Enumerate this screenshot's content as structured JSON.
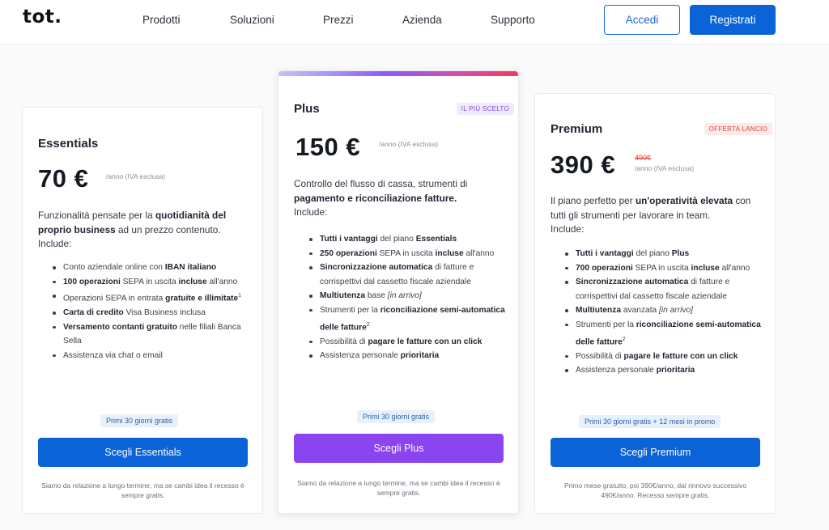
{
  "header": {
    "logo": "tot.",
    "nav": [
      "Prodotti",
      "Soluzioni",
      "Prezzi",
      "Azienda",
      "Supporto"
    ],
    "login": "Accedi",
    "signup": "Registrati"
  },
  "plans": [
    {
      "name": "Essentials",
      "price": "70 €",
      "price_note": "/anno (IVA esclusa)",
      "desc_html": "Funzionalità pensate per la <b>quotidianità del proprio business</b> ad un prezzo contenuto.<br>Include:",
      "features_html": [
        "Conto aziendale online con <b>IBAN italiano</b>",
        "<b>100 operazioni</b> SEPA in uscita <b>incluse</b> all'anno",
        "Operazioni SEPA in entrata <b>gratuite e illimitate</b><sup>1</sup>",
        "<b>Carta di credito</b> Visa Business inclusa",
        "<b>Versamento contanti gratuito</b> nelle filiali Banca Sella",
        "Assistenza via chat o email"
      ],
      "trial": "Primi 30 giorni gratis",
      "cta": "Scegli Essentials",
      "footnote": "Siamo da relazione a lungo termine, ma se cambi idea il recesso è sempre gratis."
    },
    {
      "name": "Plus",
      "badge": "IL PIÙ SCELTO",
      "price": "150 €",
      "price_note": "/anno (IVA esclusa)",
      "desc_html": "Controllo del flusso di cassa, strumenti di <b>pagamento e riconciliazione fatture.</b><br>Include:",
      "features_html": [
        "<b>Tutti i vantaggi</b> del piano <b>Essentials</b>",
        "<b>250 operazioni</b> SEPA in uscita <b>incluse</b> all'anno",
        "<b>Sincronizzazione automatica</b> di fatture e corrispettivi dal cassetto fiscale aziendale",
        "<b>Multiutenza</b> base <i>[in arrivo]</i>",
        "Strumenti per la <b>riconciliazione semi-automatica delle fatture</b><sup>2</sup>",
        "Possibilità di <b>pagare le fatture con un click</b>",
        "Assistenza personale <b>prioritaria</b>"
      ],
      "trial": "Primi 30 giorni gratis",
      "cta": "Scegli Plus",
      "footnote": "Siamo da relazione a lungo termine, ma se cambi idea il recesso è sempre gratis."
    },
    {
      "name": "Premium",
      "badge": "OFFERTA LANCIO",
      "price": "390 €",
      "old_price": "490€",
      "price_note": "/anno (IVA esclusa)",
      "desc_html": "Il piano perfetto per <b>un'operatività elevata</b> con tutti gli strumenti per lavorare in team.<br>Include:",
      "features_html": [
        "<b>Tutti i vantaggi</b> del piano <b>Plus</b>",
        "<b>700 operazioni</b> SEPA in uscita <b>incluse</b> all'anno",
        "<b>Sincronizzazione automatica</b> di fatture e corrispettivi dal cassetto fiscale aziendale",
        "<b>Multiutenza</b> avanzata <i>[in arrivo]</i>",
        "Strumenti per la <b>riconciliazione semi-automatica delle fatture</b><sup>2</sup>",
        "Possibilità di <b>pagare le fatture con un click</b>",
        "Assistenza personale <b>prioritaria</b>"
      ],
      "trial": "Primi 30 giorni gratis + 12 mesi in promo",
      "cta": "Scegli Premium",
      "footnote": "Primo mese gratuito, poi 390€/anno, dal rinnovo successivo 490€/anno. Recesso sempre gratis."
    }
  ],
  "colors": {
    "primary_blue": "#0b63d8",
    "plus_violet": "#8a44f0",
    "badge_red": "#d9423b"
  }
}
